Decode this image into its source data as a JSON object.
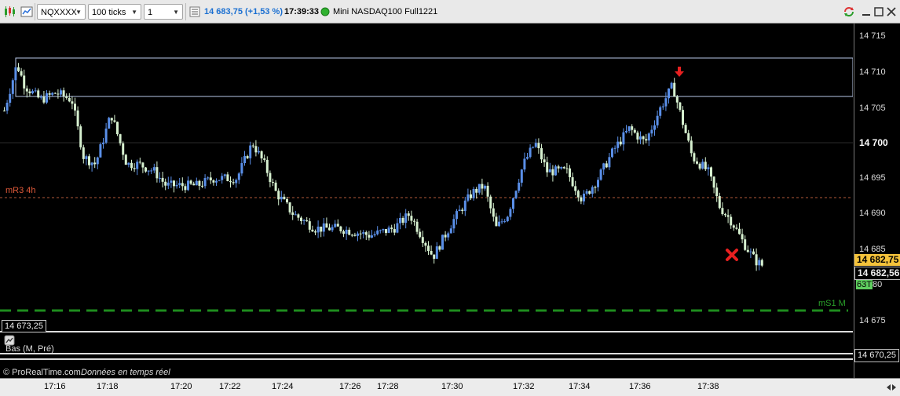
{
  "toolbar": {
    "symbol": "NQXXXX",
    "interval": "100 ticks",
    "period": "1 mois",
    "last_price": "14 683,75",
    "change": "(+1,53 %)",
    "time": "17:39:33",
    "instrument": "Mini NASDAQ100 Full1221"
  },
  "price_axis": {
    "ticks": [
      "14 715",
      "14 710",
      "14 705",
      "14 700",
      "14 695",
      "14 690",
      "14 685",
      "14 675"
    ],
    "bold_tick": "14 700",
    "current_price_tag": "14 682,75",
    "ref_price_tag": "14 682,56",
    "ticks_remaining": "63T",
    "ticks_remaining_suffix": "80",
    "lower_price_tag": "14 670,25"
  },
  "chart": {
    "level_mr3_label": "mR3 4h",
    "level_ms1_label": "mS1 M",
    "cursor_price_box": "14 673,25",
    "indicator_label": "Bas (M, Pré)",
    "colors": {
      "up_candle": "#5a8fe8",
      "down_candle": "#d6f0cf",
      "mr3_line": "#b35a3a",
      "ms1_line": "#1e8c1e",
      "current_tag_bg": "#f5c33b",
      "ref_tag_bg": "#e8e8e8",
      "ticks_tag_bg": "#5fcf5f"
    }
  },
  "status": {
    "copyright": "© ProRealTime.com",
    "realtime": "Données en temps réel"
  },
  "time_axis": {
    "labels": [
      "17:16",
      "17:18",
      "17:20",
      "17:22",
      "17:24",
      "17:26",
      "17:28",
      "17:30",
      "17:32",
      "17:34",
      "17:36",
      "17:38"
    ]
  }
}
